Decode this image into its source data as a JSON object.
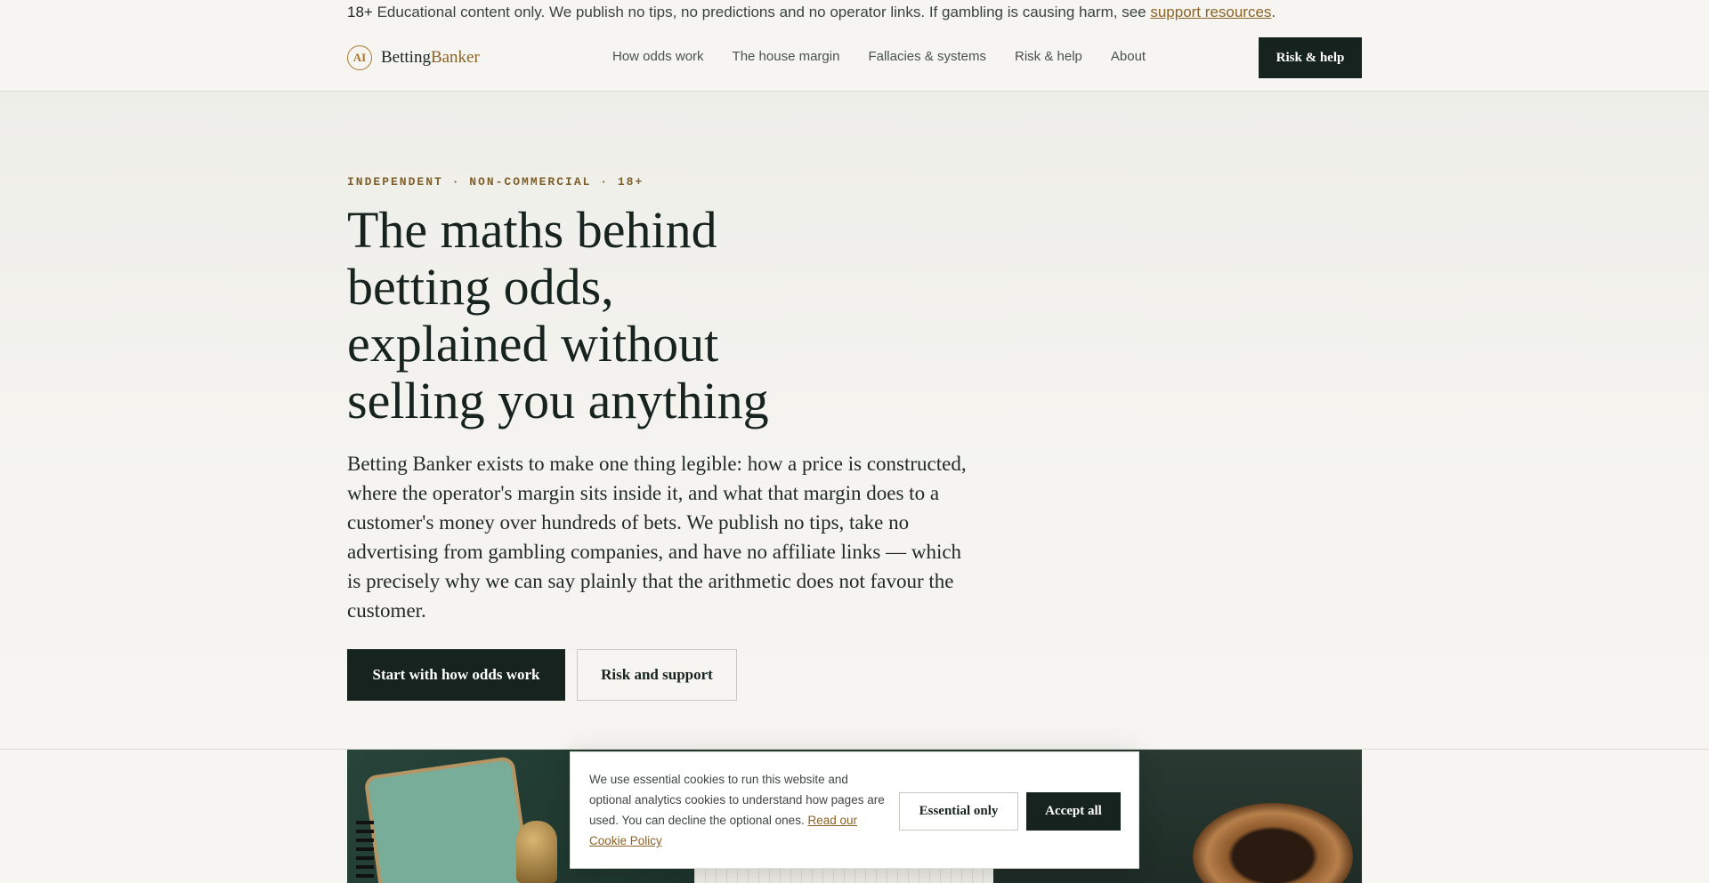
{
  "notice": {
    "age": "18+",
    "text": " Educational content only. We publish no tips, no predictions and no operator links. If gambling is causing harm, see ",
    "link": "support resources",
    "end": "."
  },
  "brand": {
    "mark": "AI",
    "name_part1": "Betting",
    "name_part2": "Banker"
  },
  "nav": {
    "items": [
      "How odds work",
      "The house margin",
      "Fallacies & systems",
      "Risk & help",
      "About"
    ],
    "cta": "Risk & help"
  },
  "hero": {
    "eyebrow": "INDEPENDENT · NON-COMMERCIAL · 18+",
    "title": "The maths behind betting odds, explained without selling you anything",
    "lead": "Betting Banker exists to make one thing legible: how a price is constructed, where the operator's margin sits inside it, and what that margin does to a customer's money over hundreds of bets. We publish no tips, take no advertising from gambling companies, and have no affiliate links — which is precisely why we can say plainly that the arithmetic does not favour the customer.",
    "primary_button": "Start with how odds work",
    "secondary_button": "Risk and support"
  },
  "cookie": {
    "text": "We use essential cookies to run this website and optional analytics cookies to understand how pages are used. You can decline the optional ones. ",
    "link": "Read our Cookie Policy",
    "essential_button": "Essential only",
    "accept_button": "Accept all"
  },
  "colors": {
    "background": "#f6f5f1",
    "ink": "#17231f",
    "accent": "#8a6326"
  }
}
